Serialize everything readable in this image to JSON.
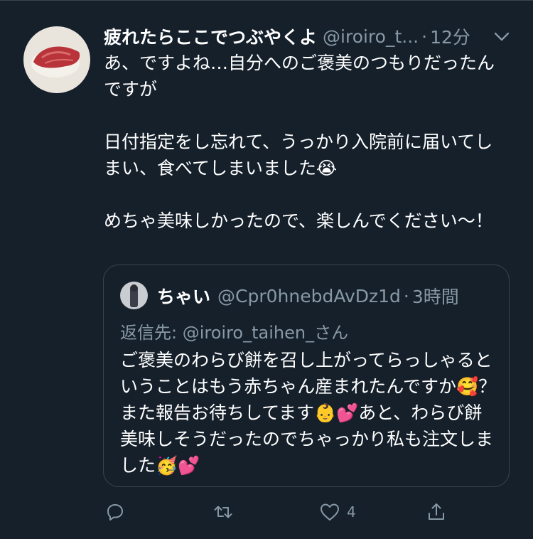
{
  "tweet": {
    "display_name": "疲れたらここでつぶやくよ",
    "handle": "@iroiro_t...",
    "separator": "·",
    "time": "12分",
    "text": "あ、ですよね…自分へのご褒美のつもりだったんですが\n\n日付指定をし忘れて、うっかり入院前に届いてしまい、食べてしまいました😭\n\nめちゃ美味しかったので、楽しんでください〜！"
  },
  "quote": {
    "display_name": "ちゃい",
    "handle": "@Cpr0hnebdAvDz1d",
    "separator": "·",
    "time": "3時間",
    "reply_to": "返信先: @iroiro_taihen_さん",
    "text": "ご褒美のわらび餅を召し上がってらっしゃるということはもう赤ちゃん産まれたんですか🥰？また報告お待ちしてます👶💕あと、わらび餅美味しそうだったのでちゃっかり私も注文しました🥳💕"
  },
  "actions": {
    "like_count": "4"
  },
  "colors": {
    "background": "#15202b",
    "secondary_text": "#8899a6",
    "border": "#38444d"
  },
  "icons": [
    "chevron-down-icon",
    "reply-icon",
    "retweet-icon",
    "like-icon",
    "share-icon"
  ]
}
